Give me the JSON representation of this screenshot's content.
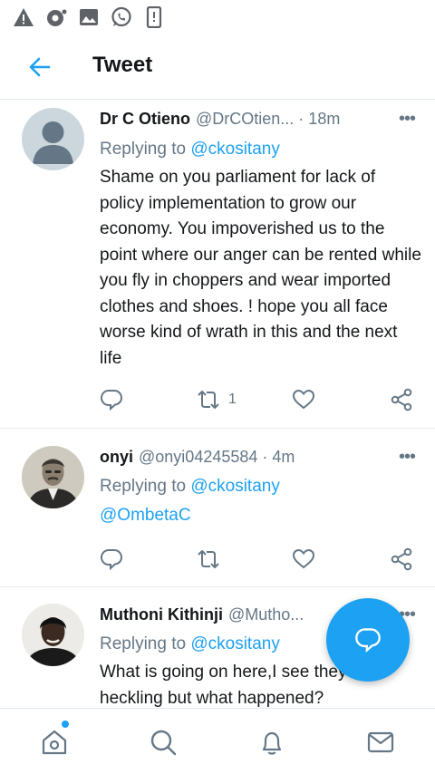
{
  "colors": {
    "accent": "#1da1f2",
    "text": "#14171a",
    "secondary": "#657786",
    "divider": "#e6ecf0"
  },
  "statusbar": {
    "icons": [
      "warning-icon",
      "app-notification-icon",
      "gallery-icon",
      "whatsapp-icon",
      "phone-device-icon"
    ]
  },
  "header": {
    "title": "Tweet",
    "back_icon": "back-arrow-icon"
  },
  "tweets": [
    {
      "name": "Dr C Otieno",
      "meta": "@DrCOtien... · 18m",
      "replying_prefix": "Replying to",
      "replying_to": [
        "@ckositany"
      ],
      "text": "Shame on you parliament for lack of policy implementation to grow our economy. You impoverished us to the point where our anger can be rented while you fly in choppers and wear imported clothes and shoes. ! hope you all face worse kind of wrath in this and the next life",
      "retweets": "1",
      "more": "•••"
    },
    {
      "name": "onyi",
      "meta": "@onyi04245584 · 4m",
      "replying_prefix": "Replying to",
      "replying_to": [
        "@ckositany",
        "@OmbetaC"
      ],
      "text": "",
      "retweets": "",
      "more": "•••"
    },
    {
      "name": "Muthoni Kithinji",
      "meta": "@Mutho...",
      "replying_prefix": "Replying to",
      "replying_to": [
        "@ckositany"
      ],
      "text": "What is going on here,I see they are heckling but what happened?",
      "retweets": "",
      "more": "•••"
    }
  ],
  "fab": {
    "icon": "compose-reply-icon"
  },
  "bottom_nav": [
    "home-icon",
    "search-icon",
    "notifications-icon",
    "messages-icon"
  ]
}
